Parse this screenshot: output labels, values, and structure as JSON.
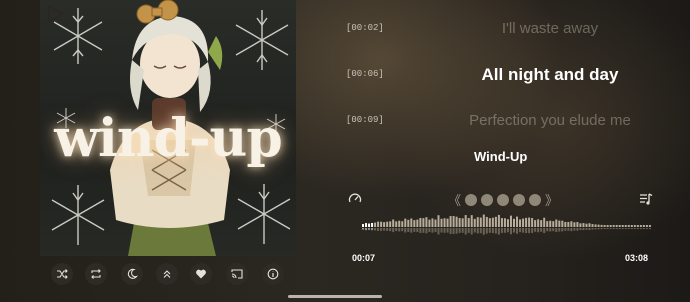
{
  "album": {
    "cover_title": "wind-up"
  },
  "lyrics": [
    {
      "time": "[00:02]",
      "text": "I'll waste away",
      "state": "dim"
    },
    {
      "time": "[00:06]",
      "text": "All night and day",
      "state": "active"
    },
    {
      "time": "[00:09]",
      "text": "Perfection you elude me",
      "state": "dim"
    }
  ],
  "now_playing": {
    "title": "Wind-Up",
    "elapsed": "00:07",
    "duration": "03:08",
    "progress": 0.037
  },
  "controls": {
    "icons": [
      "shuffle-icon",
      "repeat-icon",
      "sleep-timer-icon",
      "expand-icon",
      "favorite-icon",
      "cast-icon",
      "info-icon"
    ]
  },
  "pager": {
    "left_arrow": "《",
    "right_arrow": "》",
    "dot_count": 5
  },
  "colors": {
    "accent": "#8f8878",
    "active_lyric": "#ffffff",
    "dim_lyric": "#d2c8b9"
  }
}
